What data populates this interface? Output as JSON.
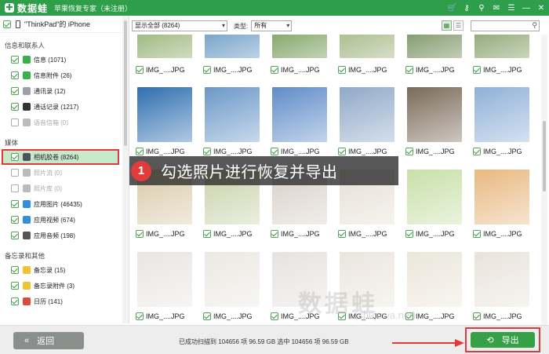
{
  "titlebar": {
    "app_name": "数据蛙",
    "app_sub": "苹果恢复专家（未注册）",
    "icons": [
      "cart-icon",
      "key-icon",
      "pin-icon",
      "chat-icon",
      "menu-icon",
      "minimize-icon",
      "close-icon"
    ],
    "icon_glyphs": [
      "🛒",
      "⚷",
      "⚲",
      "✉",
      "☰",
      "—",
      "✕"
    ]
  },
  "device": {
    "label": "\"ThinkPad\"的 iPhone"
  },
  "sidebar": {
    "groups": [
      {
        "title": "信息和联系人",
        "items": [
          {
            "label": "信息 (1071)",
            "checked": true,
            "icon_color": "#35b34a",
            "disabled": false
          },
          {
            "label": "信息附件 (26)",
            "checked": true,
            "icon_color": "#35b34a",
            "disabled": false
          },
          {
            "label": "通讯录 (12)",
            "checked": true,
            "icon_color": "#9aa0a6",
            "disabled": false
          },
          {
            "label": "通话记录 (1217)",
            "checked": true,
            "icon_color": "#333333",
            "disabled": false
          },
          {
            "label": "语音信箱 (0)",
            "checked": false,
            "icon_color": "#bbbbbb",
            "disabled": true
          }
        ]
      },
      {
        "title": "媒体",
        "items": [
          {
            "label": "相机胶卷 (8264)",
            "checked": true,
            "icon_color": "#4a5560",
            "disabled": false,
            "active": true
          },
          {
            "label": "照片流 (0)",
            "checked": false,
            "icon_color": "#bbbbbb",
            "disabled": true
          },
          {
            "label": "照片库 (0)",
            "checked": false,
            "icon_color": "#bbbbbb",
            "disabled": true
          },
          {
            "label": "应用图片 (46435)",
            "checked": true,
            "icon_color": "#2f8fe0",
            "disabled": false
          },
          {
            "label": "应用视频 (674)",
            "checked": true,
            "icon_color": "#2f8fe0",
            "disabled": false
          },
          {
            "label": "应用音频 (198)",
            "checked": true,
            "icon_color": "#555555",
            "disabled": false
          }
        ]
      },
      {
        "title": "备忘录和其他",
        "items": [
          {
            "label": "备忘录 (15)",
            "checked": true,
            "icon_color": "#f2c230",
            "disabled": false
          },
          {
            "label": "备忘录附件 (3)",
            "checked": true,
            "icon_color": "#f2c230",
            "disabled": false
          },
          {
            "label": "日历 (141)",
            "checked": true,
            "icon_color": "#e04a3a",
            "disabled": false
          }
        ]
      }
    ]
  },
  "toolbar": {
    "filter_value": "显示全部 (8264)",
    "type_label": "类型:",
    "type_value": "所有",
    "search_placeholder": ""
  },
  "grid": {
    "file_label": "IMG_....JPG",
    "rows": [
      {
        "colors": [
          "#7fa257",
          "#4a86b8",
          "#5c8a3a",
          "#8fa86b",
          "#5a7a3e",
          "#6e8f4e"
        ]
      },
      {
        "colors": [
          "#2f6fb0",
          "#6b98c8",
          "#5f8cc9",
          "#8fa9c8",
          "#7a6a58",
          "#8fb0d8"
        ]
      },
      {
        "colors": [
          "#d9c9a8",
          "#c8d2a9",
          "#d8d0c8",
          "#e6e0d4",
          "#c7e0a8",
          "#e8b880"
        ]
      },
      {
        "colors": [
          "#e8e6e2",
          "#ece8e2",
          "#e6e2e0",
          "#ebe5dd",
          "#ece6da",
          "#e9e3da"
        ]
      }
    ]
  },
  "callout": {
    "number": "1",
    "text": "勾选照片进行恢复并导出"
  },
  "bottombar": {
    "back_label": "返回",
    "status": "已成功扫描到 104656 项 96.59 GB  选中 104656 项 96.59 GB",
    "export_label": "导出"
  },
  "watermark": {
    "main": "数据蛙",
    "sub": "(shujuwa.net)"
  },
  "colors": {
    "brand": "#2f9e4b",
    "highlight": "#e23a3a",
    "active_row": "#c7e8c9"
  }
}
